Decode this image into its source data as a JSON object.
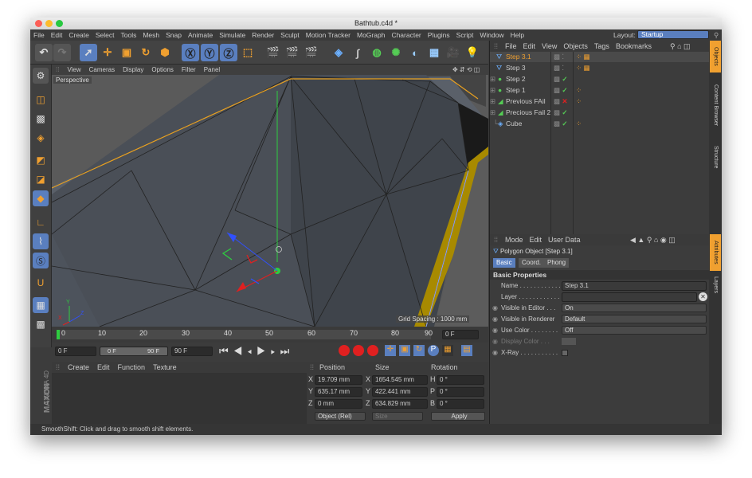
{
  "window": {
    "title": "Bathtub.c4d *"
  },
  "menu": [
    "File",
    "Edit",
    "Create",
    "Select",
    "Tools",
    "Mesh",
    "Snap",
    "Animate",
    "Simulate",
    "Render",
    "Sculpt",
    "Motion Tracker",
    "MoGraph",
    "Character",
    "Plugins",
    "Script",
    "Window",
    "Help"
  ],
  "layout": {
    "label": "Layout:",
    "value": "Startup"
  },
  "viewport": {
    "menu": [
      "View",
      "Cameras",
      "Display",
      "Options",
      "Filter",
      "Panel"
    ],
    "name": "Perspective",
    "grid_spacing": "Grid Spacing : 1000 mm",
    "axis_x": "X",
    "axis_y": "Y",
    "axis_z": "Z"
  },
  "timeline": {
    "ticks": [
      "0",
      "10",
      "20",
      "30",
      "40",
      "50",
      "60",
      "70",
      "80",
      "90"
    ],
    "frame_field": "0 F"
  },
  "transport": {
    "start": "0 F",
    "range_start": "0 F",
    "range_end": "90 F",
    "end": "90 F"
  },
  "material": {
    "menu": [
      "Create",
      "Edit",
      "Function",
      "Texture"
    ],
    "brand_top": "MAXON",
    "brand_bottom": "CINEMA 4D"
  },
  "coords": {
    "headers": [
      "Position",
      "Size",
      "Rotation"
    ],
    "rows": [
      {
        "axis": "X",
        "pos": "19.709 mm",
        "saxis": "X",
        "size": "1654.545 mm",
        "raxis": "H",
        "rot": "0 °"
      },
      {
        "axis": "Y",
        "pos": "635.17 mm",
        "saxis": "Y",
        "size": "422.441 mm",
        "raxis": "P",
        "rot": "0 °"
      },
      {
        "axis": "Z",
        "pos": "0 mm",
        "saxis": "Z",
        "size": "634.829 mm",
        "raxis": "B",
        "rot": "0 °"
      }
    ],
    "mode": "Object (Rel)",
    "size_mode": "Size",
    "apply": "Apply"
  },
  "status": "SmoothShift: Click and drag to smooth shift elements.",
  "objects": {
    "menu": [
      "File",
      "Edit",
      "View",
      "Objects",
      "Tags",
      "Bookmarks"
    ],
    "items": [
      {
        "name": "Step 3.1",
        "selected": true
      },
      {
        "name": "Step 3"
      },
      {
        "name": "Step 2"
      },
      {
        "name": "Step 1"
      },
      {
        "name": "Previous FAil"
      },
      {
        "name": "Precious Fail 2"
      },
      {
        "name": "Cube"
      }
    ]
  },
  "attributes": {
    "menu": [
      "Mode",
      "Edit",
      "User Data"
    ],
    "object_title": "Polygon Object [Step 3.1]",
    "tabs": [
      "Basic",
      "Coord.",
      "Phong"
    ],
    "section": "Basic Properties",
    "name_label": "Name . . . . . . . . . . . . .",
    "name_value": "Step 3.1",
    "layer_label": "Layer . . . . . . . . . . . .",
    "vis_editor_label": "Visible in Editor . . .",
    "vis_editor_value": "On",
    "vis_render_label": "Visible in Renderer",
    "vis_render_value": "Default",
    "use_color_label": "Use Color . . . . . . . .",
    "use_color_value": "Off",
    "display_color_label": "Display Color . . .",
    "xray_label": "X-Ray . . . . . . . . . . ."
  },
  "side_tabs": {
    "right_top": [
      "Objects",
      "Content Browser",
      "Structure"
    ],
    "right_bottom": [
      "Attributes",
      "Layers"
    ]
  },
  "colors": {
    "accent": "#f0a030",
    "selection": "#5a7fbf",
    "yellow_edge": "#b09000"
  }
}
